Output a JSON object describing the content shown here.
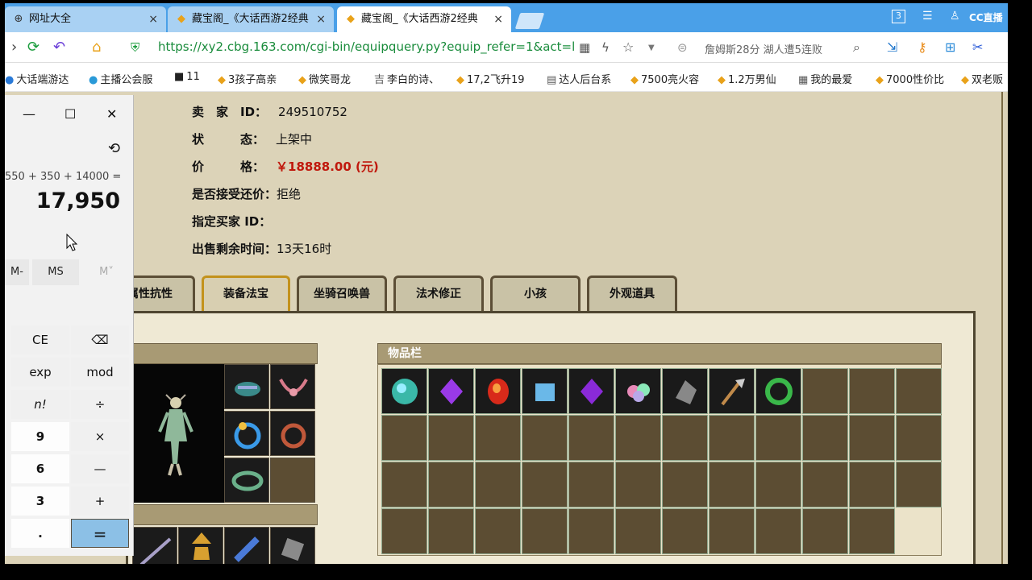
{
  "browser": {
    "tabs": [
      {
        "title": "网址大全",
        "icon": "globe-icon"
      },
      {
        "title": "藏宝阁_《大话西游2经典",
        "icon": "treasure-icon"
      },
      {
        "title": "藏宝阁_《大话西游2经典",
        "icon": "treasure-icon"
      }
    ],
    "tab_close": "×",
    "tab_count": "3",
    "cc_brand": "CC",
    "cc_brand_sub": "直播",
    "url": "https://xy2.cbg.163.com/cgi-bin/equipquery.py?equip_refer=1&act=l",
    "news_ticker": "詹姆斯28分 湖人遭5连败",
    "bookmarks": [
      "大话端游达",
      "主播公会服",
      "11",
      "3孩子高亲",
      "微笑哥龙",
      "李白的诗、",
      "17,2飞升19",
      "达人后台系",
      "7500亮火容",
      "1.2万男仙",
      "我的最爱",
      "7000性价比",
      "双老贩"
    ]
  },
  "listing": {
    "seller_label": "卖　家　ID：",
    "seller_id": "249510752",
    "status_label": "状　　　态：",
    "status_value": "上架中",
    "price_label": "价　　　格：",
    "price_value": "￥18888.00 (元)",
    "counter_offer_label": "是否接受还价：",
    "counter_offer_value": "拒绝",
    "buyer_label": "指定买家 ID：",
    "remaining_label": "出售剩余时间：",
    "remaining_value": "13天16时"
  },
  "game_tabs": [
    "属性抗性",
    "装备法宝",
    "坐骑召唤兽",
    "法术修正",
    "小孩",
    "外观道具"
  ],
  "active_game_tab": "装备法宝",
  "inventory_title": "物品栏",
  "calculator": {
    "minimize": "—",
    "maximize": "☐",
    "close": "✕",
    "expression": "550 + 350 + 14000 =",
    "result": "17,950",
    "memory_buttons": [
      "M-",
      "MS",
      "M˅"
    ],
    "buttons": [
      [
        "CE",
        "⌫"
      ],
      [
        "exp",
        "mod"
      ],
      [
        "n!",
        "÷"
      ],
      [
        "9",
        "×"
      ],
      [
        "6",
        "—"
      ],
      [
        "3",
        "+"
      ],
      [
        ".",
        "="
      ]
    ]
  },
  "colors": {
    "page_bg": "#dcd3b8",
    "price_red": "#c0180c",
    "tab_bar_blue": "#4aa0e8",
    "url_green": "#1a8c3c",
    "calc_equals_blue": "#8cc0e6"
  }
}
